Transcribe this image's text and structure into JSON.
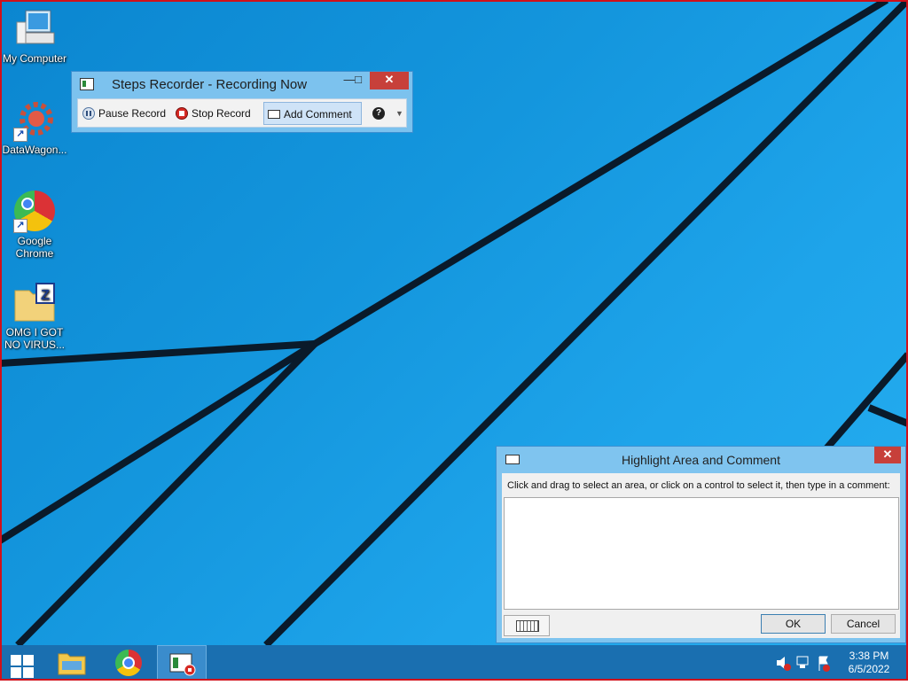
{
  "desktop": {
    "icons": [
      {
        "label": "My Computer",
        "icon": "computer-icon"
      },
      {
        "label": "DataWagon...",
        "icon": "gear-icon"
      },
      {
        "label": "Google Chrome",
        "icon": "chrome-icon"
      },
      {
        "label": "OMG I GOT NO VIRUS...",
        "icon": "zip-folder-icon"
      }
    ]
  },
  "steps_recorder": {
    "title": "Steps Recorder - Recording Now",
    "min": "—",
    "max": "□",
    "close": "✕",
    "pause_label": "Pause Record",
    "stop_label": "Stop Record",
    "add_comment_label": "Add Comment",
    "help_glyph": "?",
    "help_dropdown": "▼"
  },
  "highlight_dialog": {
    "title": "Highlight Area and Comment",
    "close": "✕",
    "instruction": "Click and drag to select an area, or click on a control to select it, then type in a comment:",
    "comment_value": "",
    "ok_label": "OK",
    "cancel_label": "Cancel"
  },
  "taskbar": {
    "time": "3:38 PM",
    "date": "6/5/2022"
  },
  "colors": {
    "accent_close": "#c7403a",
    "taskbar": "#1a6fb0",
    "frame": "#d0101a"
  }
}
